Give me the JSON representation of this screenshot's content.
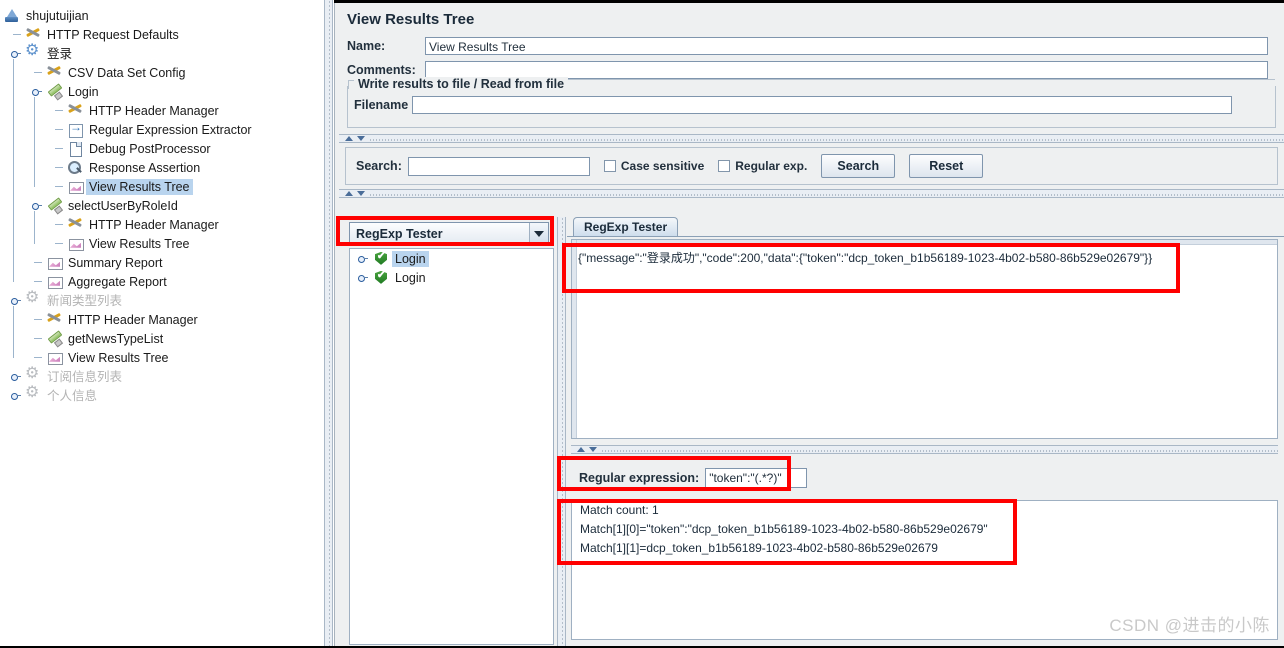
{
  "tree": {
    "items": [
      {
        "label": "shujutuijian",
        "icon": "test-plan-icon",
        "depth": 0,
        "handle": true,
        "selected": false,
        "disabled": false
      },
      {
        "label": "HTTP Request Defaults",
        "icon": "config-icon",
        "depth": 1,
        "handle": false,
        "selected": false,
        "disabled": false
      },
      {
        "label": "登录",
        "icon": "thread-group-icon",
        "depth": 1,
        "handle": true,
        "selected": false,
        "disabled": false
      },
      {
        "label": "CSV Data Set Config",
        "icon": "config-icon",
        "depth": 2,
        "handle": false,
        "selected": false,
        "disabled": false
      },
      {
        "label": "Login",
        "icon": "sampler-icon",
        "depth": 2,
        "handle": true,
        "selected": false,
        "disabled": false
      },
      {
        "label": "HTTP Header Manager",
        "icon": "config-icon",
        "depth": 3,
        "handle": false,
        "selected": false,
        "disabled": false
      },
      {
        "label": "Regular Expression Extractor",
        "icon": "extractor-icon",
        "depth": 3,
        "handle": false,
        "selected": false,
        "disabled": false
      },
      {
        "label": "Debug PostProcessor",
        "icon": "document-icon",
        "depth": 3,
        "handle": false,
        "selected": false,
        "disabled": false
      },
      {
        "label": "Response Assertion",
        "icon": "assertion-icon",
        "depth": 3,
        "handle": false,
        "selected": false,
        "disabled": false
      },
      {
        "label": "View Results Tree",
        "icon": "listener-icon",
        "depth": 3,
        "handle": false,
        "selected": true,
        "disabled": false
      },
      {
        "label": "selectUserByRoleId",
        "icon": "sampler-icon",
        "depth": 2,
        "handle": true,
        "selected": false,
        "disabled": false
      },
      {
        "label": "HTTP Header Manager",
        "icon": "config-icon",
        "depth": 3,
        "handle": false,
        "selected": false,
        "disabled": false
      },
      {
        "label": "View Results Tree",
        "icon": "listener-icon",
        "depth": 3,
        "handle": false,
        "selected": false,
        "disabled": false
      },
      {
        "label": "Summary Report",
        "icon": "listener-icon",
        "depth": 2,
        "handle": false,
        "selected": false,
        "disabled": false
      },
      {
        "label": "Aggregate Report",
        "icon": "listener-icon",
        "depth": 2,
        "handle": false,
        "selected": false,
        "disabled": false
      },
      {
        "label": "新闻类型列表",
        "icon": "thread-group-disabled-icon",
        "depth": 1,
        "handle": true,
        "selected": false,
        "disabled": true
      },
      {
        "label": "HTTP Header Manager",
        "icon": "config-icon",
        "depth": 2,
        "handle": false,
        "selected": false,
        "disabled": false
      },
      {
        "label": "getNewsTypeList",
        "icon": "sampler-icon",
        "depth": 2,
        "handle": false,
        "selected": false,
        "disabled": false
      },
      {
        "label": "View Results Tree",
        "icon": "listener-icon",
        "depth": 2,
        "handle": false,
        "selected": false,
        "disabled": false
      },
      {
        "label": "订阅信息列表",
        "icon": "thread-group-disabled-icon",
        "depth": 1,
        "handle": true,
        "selected": false,
        "disabled": true
      },
      {
        "label": "个人信息",
        "icon": "thread-group-disabled-icon",
        "depth": 1,
        "handle": true,
        "selected": false,
        "disabled": true
      }
    ]
  },
  "panel": {
    "title": "View Results Tree",
    "name_label": "Name:",
    "name_value": "View Results Tree",
    "comments_label": "Comments:",
    "comments_value": "",
    "group_title": "Write results to file / Read from file",
    "filename_label": "Filename",
    "filename_value": ""
  },
  "search": {
    "label": "Search:",
    "value": "",
    "case_sensitive_label": "Case sensitive",
    "case_sensitive_checked": false,
    "regular_exp_label": "Regular exp.",
    "regular_exp_checked": false,
    "search_button": "Search",
    "reset_button": "Reset"
  },
  "render_combo": {
    "selected": "RegExp Tester",
    "arrow_icon": "chevron-down-icon"
  },
  "results": {
    "rows": [
      {
        "label": "Login",
        "status_icon": "success-shield-icon",
        "selected": true
      },
      {
        "label": "Login",
        "status_icon": "success-shield-icon",
        "selected": false
      }
    ]
  },
  "detail": {
    "tab_label": "RegExp Tester",
    "response_text": "{\"message\":\"登录成功\",\"code\":200,\"data\":{\"token\":\"dcp_token_b1b56189-1023-4b02-b580-86b529e02679\"}}",
    "regex_label": "Regular expression:",
    "regex_value": "\"token\":\"(.*?)\"",
    "match_lines": [
      "Match count: 1",
      "Match[1][0]=\"token\":\"dcp_token_b1b56189-1023-4b02-b580-86b529e02679\"",
      "Match[1][1]=dcp_token_b1b56189-1023-4b02-b580-86b529e02679"
    ]
  },
  "annotations": {
    "highlight_color": "#ff0000",
    "count": 4
  },
  "watermark": "CSDN @进击的小陈"
}
